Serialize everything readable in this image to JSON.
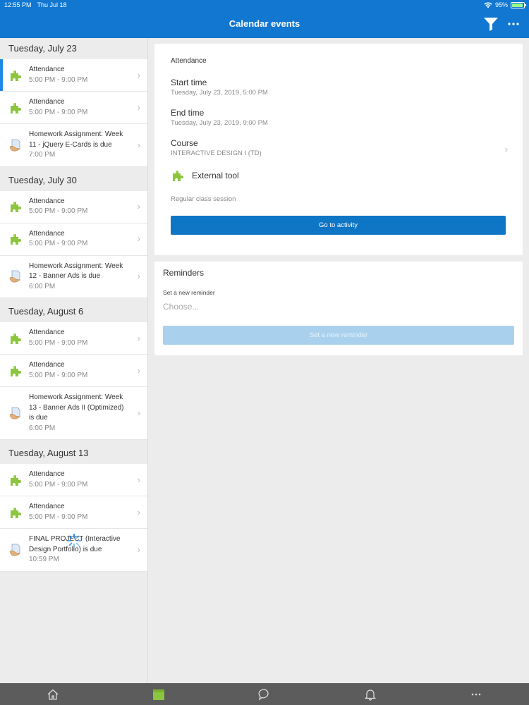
{
  "status": {
    "time": "12:55 PM",
    "date": "Thu Jul 18",
    "battery": "95%",
    "battery_level": 0.95
  },
  "navbar": {
    "title": "Calendar events"
  },
  "sidebar": {
    "groups": [
      {
        "date": "Tuesday, July 23",
        "events": [
          {
            "title": "Attendance",
            "time": "5:00 PM - 9:00 PM",
            "icon": "puzzle-icon",
            "selected": true
          },
          {
            "title": "Attendance",
            "time": "5:00 PM - 9:00 PM",
            "icon": "puzzle-icon"
          },
          {
            "title": "Homework Assignment: Week 11 - jQuery E-Cards is due",
            "time": "7:00 PM",
            "icon": "assignment-icon"
          }
        ]
      },
      {
        "date": "Tuesday, July 30",
        "events": [
          {
            "title": "Attendance",
            "time": "5:00 PM - 9:00 PM",
            "icon": "puzzle-icon"
          },
          {
            "title": "Attendance",
            "time": "5:00 PM - 9:00 PM",
            "icon": "puzzle-icon"
          },
          {
            "title": "Homework Assignment: Week 12 - Banner Ads is due",
            "time": "6:00 PM",
            "icon": "assignment-icon"
          }
        ]
      },
      {
        "date": "Tuesday, August 6",
        "events": [
          {
            "title": "Attendance",
            "time": "5:00 PM - 9:00 PM",
            "icon": "puzzle-icon"
          },
          {
            "title": "Attendance",
            "time": "5:00 PM - 9:00 PM",
            "icon": "puzzle-icon"
          },
          {
            "title": "Homework Assignment: Week 13 - Banner Ads II (Optimized) is due",
            "time": "6:00 PM",
            "icon": "assignment-icon"
          }
        ]
      },
      {
        "date": "Tuesday, August 13",
        "events": [
          {
            "title": "Attendance",
            "time": "5:00 PM - 9:00 PM",
            "icon": "puzzle-icon"
          },
          {
            "title": "Attendance",
            "time": "5:00 PM - 9:00 PM",
            "icon": "puzzle-icon"
          },
          {
            "title": "FINAL PROJECT (Interactive Design Portfolio) is due",
            "time": "10:59 PM",
            "icon": "assignment-icon"
          }
        ]
      }
    ]
  },
  "detail": {
    "name": "Attendance",
    "start_label": "Start time",
    "start_value": "Tuesday, July 23, 2019, 5:00 PM",
    "end_label": "End time",
    "end_value": "Tuesday, July 23, 2019, 9:00 PM",
    "course_label": "Course",
    "course_value": "INTERACTIVE DESIGN I (TD)",
    "tool_label": "External tool",
    "description": "Regular class session",
    "go_button": "Go to activity"
  },
  "reminders": {
    "title": "Reminders",
    "label": "Set a new reminder",
    "placeholder": "Choose...",
    "button": "Set a new reminder"
  },
  "tabbar": {
    "tabs": [
      "home-icon",
      "calendar-icon",
      "messages-icon",
      "notifications-icon",
      "more-icon"
    ],
    "active": "calendar-icon"
  },
  "colors": {
    "brand": "#1177d1",
    "primary_button": "#0f75c5",
    "selected_accent": "#1e88e5",
    "tabbar": "#5c5c5c",
    "puzzle_green": "#8cc63f"
  }
}
